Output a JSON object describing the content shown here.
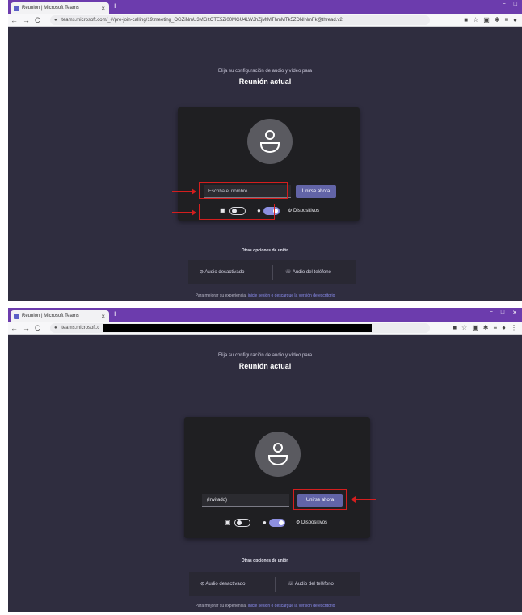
{
  "colors": {
    "accent": "#6264a7",
    "titlebar": "#6c3cad",
    "background": "#2f2d3f",
    "highlight": "#d41e1e"
  },
  "shot1": {
    "tab_title": "Reunión | Microsoft Teams",
    "tab_close": "×",
    "new_tab": "+",
    "window_controls": [
      "−",
      "□"
    ],
    "nav": [
      "←",
      "→",
      "C"
    ],
    "url": "teams.microsoft.com/_#/pre-join-calling/19:meeting_OGZiNmU3MGItOTE5Zi00MGU4LWJhZjMtMThmMTk5ZDNlNmFk@thread.v2",
    "ext_icons": [
      "■",
      "☆",
      "▣",
      "✱",
      "≡",
      "●"
    ],
    "subheading": "Elija su configuración de audio y vídeo para",
    "heading": "Reunión actual",
    "name_placeholder": "Escriba el nombre",
    "join_label": "Unirse ahora",
    "devices_label": "Dispositivos",
    "camera_icon": "video-off-icon",
    "mic_icon": "microphone-icon",
    "other_title": "Otras opciones de unión",
    "audio_off": "Audio desactivado",
    "phone_audio": "Audio del teléfono",
    "footer_text": "Para mejorar su experiencia, ",
    "footer_link": "inicie sesión o descargue la versión de escritorio"
  },
  "shot2": {
    "tab_title": "Reunión | Microsoft Teams",
    "tab_close": "×",
    "new_tab": "+",
    "window_controls": [
      "−",
      "□",
      "✕"
    ],
    "nav": [
      "←",
      "→",
      "C"
    ],
    "url": "teams.microsoft.c",
    "ext_icons": [
      "■",
      "☆",
      "▣",
      "✱",
      "≡",
      "●",
      "⋮"
    ],
    "subheading": "Elija su configuración de audio y vídeo para",
    "heading": "Reunión actual",
    "name_value": "(Invitado)",
    "join_label": "Unirse ahora",
    "devices_label": "Dispositivos",
    "other_title": "Otras opciones de unión",
    "audio_off": "Audio desactivado",
    "phone_audio": "Audio del teléfono",
    "footer_text": "Para mejorar su experiencia, ",
    "footer_link": "inicie sesión o descargue la versión de escritorio"
  }
}
